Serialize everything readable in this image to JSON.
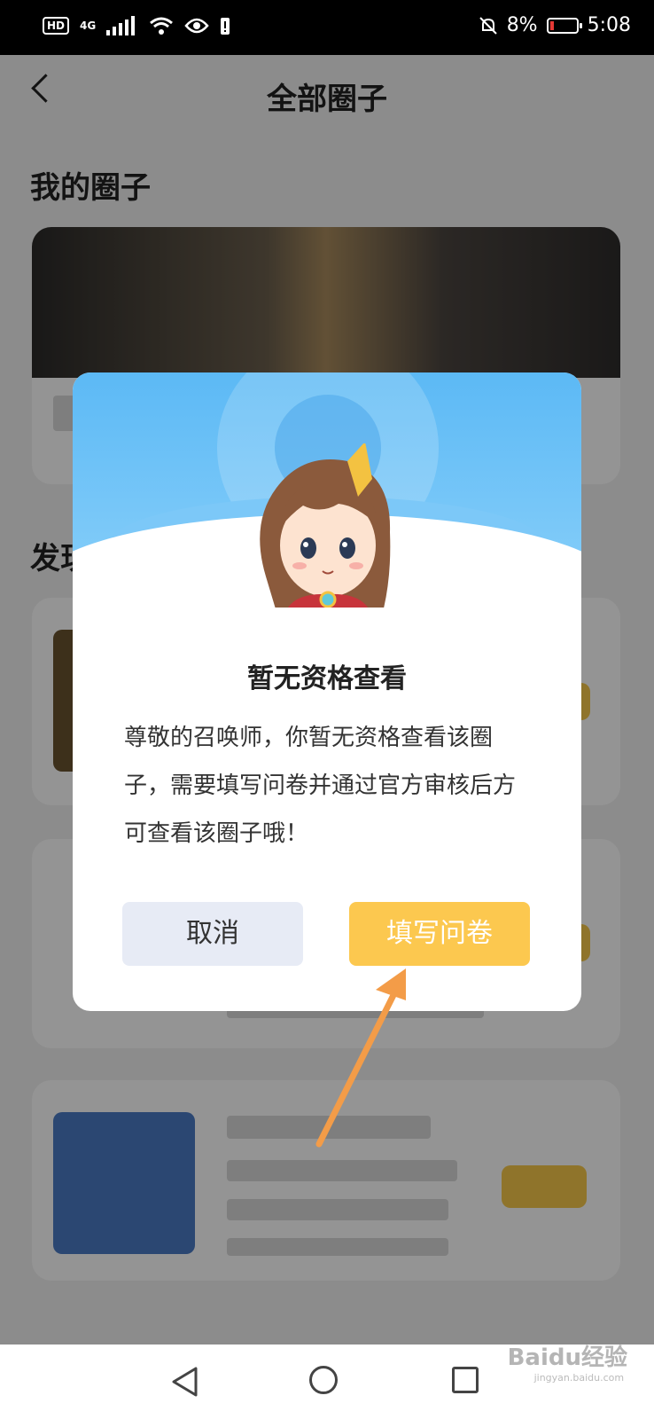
{
  "status_bar": {
    "hd": "HD",
    "network": "4G",
    "battery_pct": "8%",
    "time": "5:08",
    "battery_level": 0.08,
    "icons": [
      "signal-icon",
      "wifi-icon",
      "eye-icon",
      "battery-alert-icon",
      "mute-icon",
      "battery-icon"
    ]
  },
  "header": {
    "title": "全部圈子",
    "back_icon": "chevron-left-icon"
  },
  "sections": {
    "my_circles": "我的圈子",
    "discover_partial": "发现"
  },
  "modal": {
    "title": "暂无资格查看",
    "message": "尊敬的召唤师，你暂无资格查看该圈子，需要填写问卷并通过官方审核后方可查看该圈子哦！",
    "cancel_label": "取消",
    "confirm_label": "填写问卷",
    "illustration": "mascot-girl-illustration"
  },
  "annotation": {
    "arrow_color": "#f39c48",
    "points_to": "confirm-button"
  },
  "nav_bar": {
    "icons": [
      "nav-back-icon",
      "nav-home-icon",
      "nav-recents-icon"
    ]
  },
  "watermark": {
    "text": "Baidu经验",
    "sub": "jingyan.baidu.com"
  },
  "colors": {
    "accent": "#fcc84f",
    "cancel_bg": "#e7ebf5",
    "modal_top": "#5cb9f5"
  }
}
